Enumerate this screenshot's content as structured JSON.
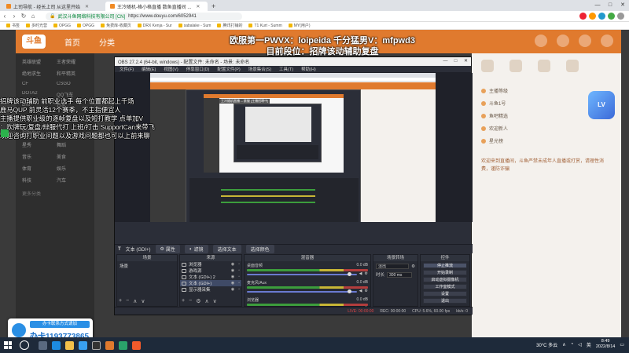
{
  "browser": {
    "tabs": [
      {
        "label": "上司导航 - 经长上司 从这里开始",
        "active": false
      },
      {
        "label": "王冷随机-格小格直播 数鱼直播间 ...",
        "active": true
      }
    ],
    "new_tab": "+",
    "url": "https://www.douyu.com/6052941",
    "url_owner": "武汉斗鱼网络科技有限公司 [CN]",
    "bookmarks": [
      "书签",
      "多时光营",
      "OPGG",
      "OPGG",
      "免费库-收藏页",
      "DRX Kenja - Sur",
      "sabalake - Sum",
      "腾讯打铺的",
      "T1 Kurt - Summ",
      "MY(用户)"
    ],
    "window_controls": [
      "—",
      "□",
      "✕"
    ]
  },
  "douyu": {
    "logo": "斗鱼",
    "nav": [
      "首页",
      "分类"
    ],
    "sidebar_items": [
      "英雄联盟",
      "王者荣耀",
      "绝地求生",
      "和平精英",
      "CF",
      "CSGO",
      "DOTA2",
      "QQ飞车",
      "DNF",
      "户外",
      "颜值",
      "二次元",
      "星秀",
      "舞蹈",
      "音乐",
      "美食",
      "体育",
      "娱乐",
      "科技",
      "汽车"
    ],
    "sidebar_sections": [
      "精彩推荐",
      "更多分类"
    ],
    "right_items": [
      "主播等级",
      "斗鱼1号",
      "鱼吧精选",
      "欢迎新人",
      "星光榜"
    ],
    "right_text": "欢迎来到直播间，斗鱼严禁未成年人直播或打赏，请理性消费，谨防诈骗"
  },
  "banner": {
    "line1": "欧服第一PWVX：loipeida 千分猛男V：mfpwd3",
    "line2": "目前段位：招牌该动辅助复盘"
  },
  "left_overlay": [
    "招牌该动辅助 前职业选手 每个位置都起上千场",
    "鹿马QUP 前灵活12个赛季，不主指便宜人",
    "主播提供职业级的逐帧复盘以及短打教学 点单加V",
    "：吹牌玩/复盘/辩服代打 上班/打击 SupportCan来带飞",
    "欢迎咨询打职业问题以及游戏问题都也可以上前来聊"
  ],
  "contact": {
    "header": "办卡联系方式请加",
    "number": "办卡1193773865"
  },
  "obs": {
    "title": "OBS 27.2.4 (64-bit, windows) - 配置文件: 未命名 - 场景: 未命名",
    "menu": [
      "文件(F)",
      "编辑(E)",
      "视图(V)",
      "停靠窗口(D)",
      "配置文件(P)",
      "场景集合(S)",
      "工具(T)",
      "帮助(H)"
    ],
    "nested_url_text": "王冷随机直播 -- 欧服 [主播招聘中]",
    "context_bar": {
      "label": "文本 (GDI+)",
      "props": "属性",
      "filters": "滤镜",
      "select_text": "选择文本",
      "choose_file": "选择颜色"
    },
    "dock_scenes": {
      "title": "场景",
      "items": [
        "场景"
      ]
    },
    "dock_sources": {
      "title": "来源",
      "items": [
        {
          "label": "浏览器",
          "selected": false
        },
        {
          "label": "游戏源",
          "selected": false
        },
        {
          "label": "文本 (GDI+) 2",
          "selected": false
        },
        {
          "label": "文本 (GDI+)",
          "selected": true
        },
        {
          "label": "显示器采集",
          "selected": false
        }
      ]
    },
    "dock_mixer": {
      "title": "混音器",
      "channels": [
        {
          "name": "桌面音频",
          "level": "0.0 dB",
          "volume": 0.92
        },
        {
          "name": "麦克风/Aux",
          "level": "0.0 dB",
          "volume": 0.92
        },
        {
          "name": "浏览器",
          "level": "0.0 dB",
          "volume": 0.92
        }
      ]
    },
    "dock_transitions": {
      "title": "场景转场",
      "type": "淡出",
      "duration_label": "时长",
      "duration_value": "300 ms"
    },
    "dock_controls": {
      "title": "控件",
      "buttons": [
        {
          "label": "停止推流",
          "on": true
        },
        {
          "label": "开始录制",
          "on": false
        },
        {
          "label": "启动虚拟摄像机",
          "on": false
        },
        {
          "label": "工作室模式",
          "on": false
        },
        {
          "label": "设置",
          "on": false
        },
        {
          "label": "退出",
          "on": false
        }
      ]
    },
    "status": {
      "live": "LIVE: 00:00:00",
      "rec": "REC: 00:00:00",
      "cpu": "CPU: 5.6%, 60.00 fps",
      "kbps": "kb/s: 0"
    }
  },
  "taskbar": {
    "weather": "30°C 多云",
    "ime": "英",
    "time": "8:49",
    "date": "2022/8/14"
  },
  "colors": {
    "douyu_orange": "#e07a2e",
    "obs_dark": "#2b2e38",
    "qq_blue": "#2a8fe5"
  }
}
